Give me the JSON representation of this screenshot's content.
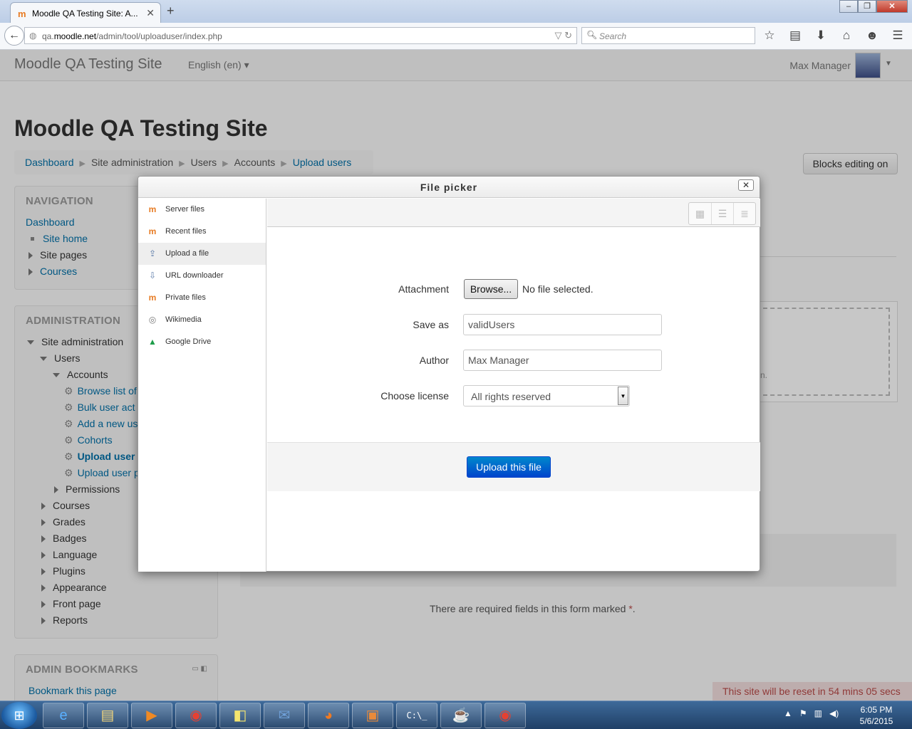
{
  "browser": {
    "tab_title": "Moodle QA Testing Site: A...",
    "tab_favicon": "m",
    "url_prefix": "qa.",
    "url_host": "moodle.net",
    "url_path": "/admin/tool/uploaduser/index.php",
    "search_placeholder": "Search"
  },
  "site": {
    "brand": "Moodle QA Testing Site",
    "language": "English (en)",
    "user": "Max Manager",
    "page_title": "Moodle QA Testing Site",
    "blocks_editing": "Blocks editing on"
  },
  "breadcrumb": [
    "Dashboard",
    "Site administration",
    "Users",
    "Accounts",
    "Upload users"
  ],
  "navigation": {
    "title": "NAVIGATION",
    "items": [
      "Dashboard",
      "Site home",
      "Site pages",
      "Courses"
    ]
  },
  "administration": {
    "title": "ADMINISTRATION",
    "site_admin": "Site administration",
    "users": "Users",
    "accounts": "Accounts",
    "account_items": [
      "Browse list of",
      "Bulk user act",
      "Add a new us",
      "Cohorts",
      "Upload user",
      "Upload user p"
    ],
    "permissions": "Permissions",
    "sections": [
      "Courses",
      "Grades",
      "Badges",
      "Language",
      "Plugins",
      "Appearance",
      "Front page",
      "Reports"
    ]
  },
  "bookmarks": {
    "title": "ADMIN BOOKMARKS",
    "link": "Bookmark this page"
  },
  "required_note": "There are required fields in this form marked",
  "required_star": "*",
  "required_dot": ".",
  "dashed_text": "n.",
  "reset_note": "This site will be reset in 54 mins 05 secs",
  "file_picker": {
    "title": "File picker",
    "repositories": [
      "Server files",
      "Recent files",
      "Upload a file",
      "URL downloader",
      "Private files",
      "Wikimedia",
      "Google Drive"
    ],
    "attachment_label": "Attachment",
    "browse_label": "Browse...",
    "no_file": "No file selected.",
    "save_as_label": "Save as",
    "save_as_value": "validUsers",
    "author_label": "Author",
    "author_value": "Max Manager",
    "license_label": "Choose license",
    "license_value": "All rights reserved",
    "upload_button": "Upload this file"
  },
  "taskbar": {
    "time": "6:05 PM",
    "date": "5/6/2015"
  }
}
